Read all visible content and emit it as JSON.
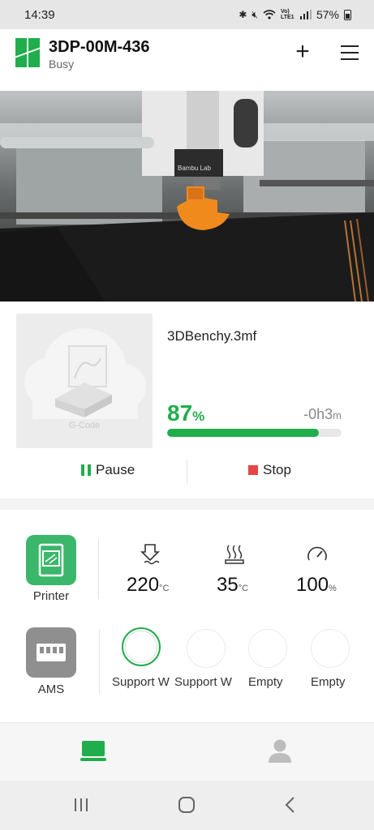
{
  "status_bar": {
    "time": "14:39",
    "network_label": "Vo) LTE1",
    "battery": "57%"
  },
  "header": {
    "title": "3DP-00M-436",
    "status": "Busy"
  },
  "camera": {
    "brand_text": "Bambu Lab"
  },
  "job": {
    "filename": "3DBenchy.3mf",
    "thumbnail_label": "G-Code",
    "progress_percent": 87,
    "progress_value": "87",
    "progress_unit": "%",
    "remaining_value": "-0h3",
    "remaining_unit": "m",
    "pause_label": "Pause",
    "stop_label": "Stop",
    "colors": {
      "accent": "#1fae4b",
      "stop": "#e54545"
    }
  },
  "printer_panel": {
    "printer_label": "Printer",
    "ams_label": "AMS",
    "nozzle": {
      "value": "220",
      "unit": "°C",
      "icon": "nozzle-temp-icon"
    },
    "bed": {
      "value": "35",
      "unit": "°C",
      "icon": "bed-heat-icon"
    },
    "speed": {
      "value": "100",
      "unit": "%",
      "icon": "speedometer-icon"
    },
    "ams_slots": [
      {
        "label": "Support W",
        "active": true
      },
      {
        "label": "Support W",
        "active": false
      },
      {
        "label": "Empty",
        "active": false
      },
      {
        "label": "Empty",
        "active": false
      }
    ]
  },
  "bottom_nav": {
    "items": [
      {
        "icon": "printer-tab-icon",
        "active": true
      },
      {
        "icon": "user-profile-icon",
        "active": false
      }
    ]
  }
}
